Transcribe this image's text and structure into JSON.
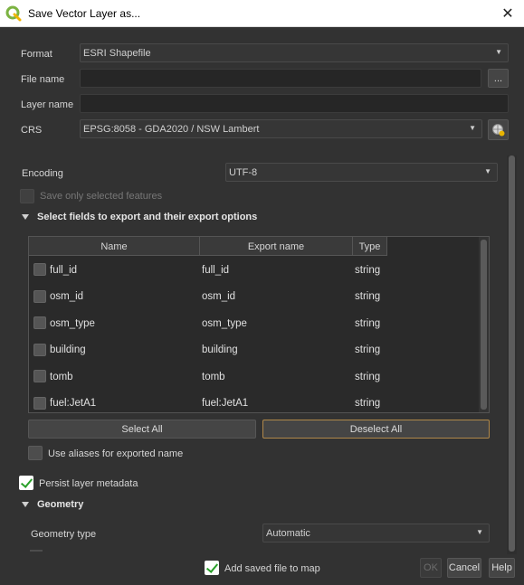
{
  "window": {
    "title": "Save Vector Layer as...",
    "close_glyph": "✕"
  },
  "form": {
    "format_label": "Format",
    "format_value": "ESRI Shapefile",
    "filename_label": "File name",
    "filename_value": "",
    "browse_label": "...",
    "layername_label": "Layer name",
    "layername_value": "",
    "crs_label": "CRS",
    "crs_value": "EPSG:8058 - GDA2020 / NSW Lambert",
    "encoding_label": "Encoding",
    "encoding_value": "UTF-8",
    "save_selected_label": "Save only selected features",
    "save_selected_checked": false
  },
  "fields_section": {
    "title": "Select fields to export and their export options",
    "headers": [
      "Name",
      "Export name",
      "Type"
    ],
    "rows": [
      {
        "name": "full_id",
        "export": "full_id",
        "type": "string"
      },
      {
        "name": "osm_id",
        "export": "osm_id",
        "type": "string"
      },
      {
        "name": "osm_type",
        "export": "osm_type",
        "type": "string"
      },
      {
        "name": "building",
        "export": "building",
        "type": "string"
      },
      {
        "name": "tomb",
        "export": "tomb",
        "type": "string"
      },
      {
        "name": "fuel:JetA1",
        "export": "fuel:JetA1",
        "type": "string"
      }
    ],
    "select_all_label": "Select All",
    "deselect_all_label": "Deselect All",
    "aliases_label": "Use aliases for exported name"
  },
  "metadata": {
    "persist_label": "Persist layer metadata",
    "persist_checked": true
  },
  "geometry": {
    "title": "Geometry",
    "type_label": "Geometry type",
    "type_value": "Automatic"
  },
  "footer": {
    "add_saved_label": "Add saved file to map",
    "add_saved_checked": true,
    "ok_label": "OK",
    "cancel_label": "Cancel",
    "help_label": "Help"
  },
  "colors": {
    "accent_green": "#2aa02a",
    "dialog_bg": "#323232",
    "qgis_logo": "#7cb342"
  }
}
